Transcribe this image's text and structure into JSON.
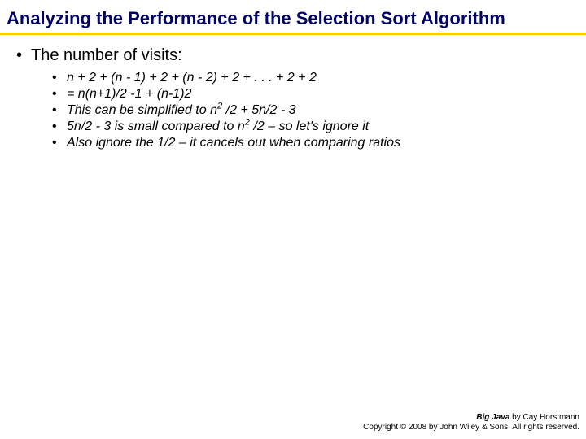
{
  "title": "Analyzing the Performance of the Selection Sort Algorithm",
  "main_bullet": "The number of visits:",
  "sub_bullets": [
    {
      "pre": "n + 2 + (n - 1) + 2 + (n - 2) + 2 + . . . + 2 + 2"
    },
    {
      "pre": "= n(n+1)/2 -1 + (n-1)2"
    },
    {
      "pre": "This can be simplified to n",
      "sup1": "2",
      "mid": " /2  +  5n/2  - 3"
    },
    {
      "pre": "5n/2 - 3 is small compared to n",
      "sup1": "2",
      "mid": " /2 – so let's ignore it"
    },
    {
      "pre": "Also ignore the 1/2 – it cancels out when comparing ratios"
    }
  ],
  "footer": {
    "book": "Big Java",
    "by": " by Cay Horstmann",
    "copyright": "Copyright © 2008 by John Wiley & Sons. All rights reserved."
  }
}
